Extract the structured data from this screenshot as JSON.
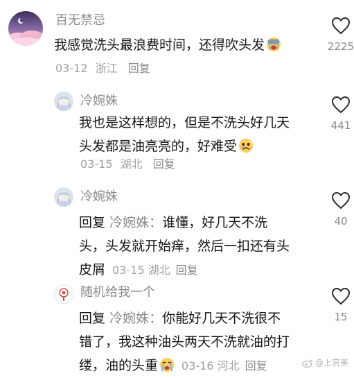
{
  "comments": [
    {
      "username": "百无禁忌",
      "lines": [
        "我感觉洗头最浪费时间，还得吹头发"
      ],
      "date": "03-12",
      "location": "浙江",
      "reply_label": "回复",
      "likes": "2225"
    },
    {
      "username": "冷婉姝",
      "lines": [
        "我也是这样想的，但是不洗头好几天",
        "头发都是油亮亮的，好难受"
      ],
      "date": "03-15",
      "location": "湖北",
      "reply_label": "回复",
      "likes": "441"
    },
    {
      "username": "冷婉姝",
      "reply_prefix": "回复",
      "mention": "冷婉姝：",
      "lines": [
        "谁懂，好几天不洗",
        "头，头发就开始痒，然后一扣还有头",
        "皮屑"
      ],
      "date": "03-15",
      "location": "湖北",
      "reply_label": "回复",
      "likes": "40"
    },
    {
      "username": "随机给我一个",
      "reply_prefix": "回复",
      "mention": "冷婉姝：",
      "lines": [
        "你能好几天不洗很不",
        "错了，我这种油头两天不洗就油的打",
        "缕，油的头重"
      ],
      "date": "03-16",
      "location": "河北",
      "reply_label": "回复",
      "likes": "15"
    }
  ],
  "watermark": "@上官美",
  "colors": {
    "primary_text": "#161616",
    "secondary_text": "#8a8a8a",
    "meta_text": "#a0a0a0"
  }
}
